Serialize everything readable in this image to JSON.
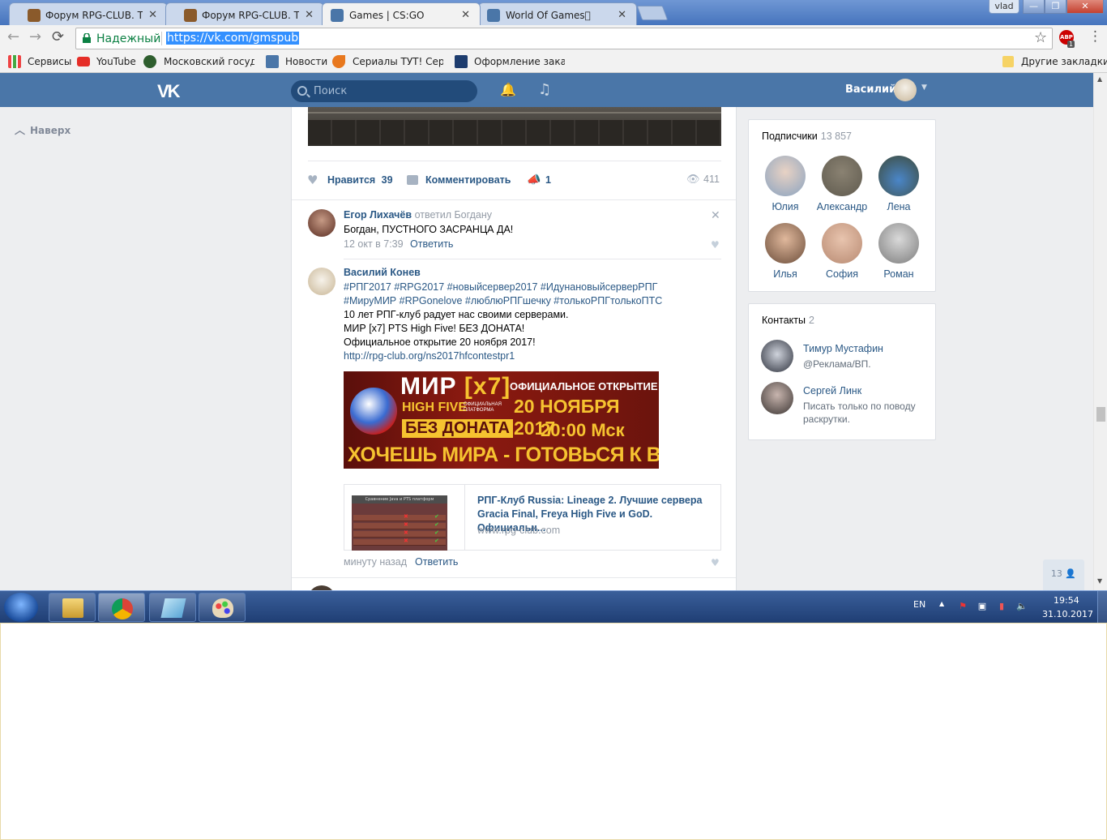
{
  "browser": {
    "tabs": [
      {
        "title": "Форум RPG-CLUB. Тема",
        "icon_color": "#8a5a2b",
        "active": false
      },
      {
        "title": "Форум RPG-CLUB. Тема",
        "icon_color": "#8a5a2b",
        "active": false
      },
      {
        "title": "Games | CS:GO",
        "icon_color": "#4a76a8",
        "active": true
      },
      {
        "title": "World Of Games\u0000",
        "icon_color": "#4a76a8",
        "active": false
      }
    ],
    "close_glyph": "✕",
    "profile_badge": "vlad",
    "window_controls": {
      "minimize": "—",
      "maximize": "❐",
      "close": "✕"
    },
    "nav": {
      "back": "←",
      "forward": "→",
      "reload": "⟳"
    },
    "secure_label": "Надежный",
    "url": "https://vk.com/gmspub",
    "star_glyph": "☆",
    "abp_label": "ABP",
    "abp_count": "1",
    "menu_glyph": "⋮",
    "bookmarks": [
      {
        "label": "Сервисы",
        "icon": "apps-grid-icon"
      },
      {
        "label": "YouTube",
        "icon": "youtube-icon"
      },
      {
        "label": "Московский государ",
        "icon": "emblem-icon"
      },
      {
        "label": "Новости",
        "icon": "vk-icon"
      },
      {
        "label": "Сериалы ТУТ! Сериа",
        "icon": "fox-icon"
      },
      {
        "label": "Оформление заказа",
        "icon": "sp-icon"
      }
    ],
    "other_bookmarks": "Другие закладки"
  },
  "vk": {
    "logo": "VK",
    "search_placeholder": "Поиск",
    "user_name": "Василий",
    "go_top": "Наверх",
    "post_actions": {
      "like_label": "Нравится",
      "like_count": "39",
      "comment_label": "Комментировать",
      "share_count": "1",
      "views": "411"
    },
    "comments": [
      {
        "author": "Егор Лихачёв",
        "replied": "ответил Богдану",
        "text": "Богдан, ПУСТНОГО ЗАСРАНЦА ДА!",
        "date": "12 окт в 7:39",
        "reply": "Ответить"
      },
      {
        "author": "Василий Конев",
        "hashtags1": "#РПГ2017 #RPG2017 #новыйсервер2017 #ИдунановыйсерверРПГ",
        "hashtags2": "#МируМИР #RPGonelove #люблюРПГшечку #толькоРПГтолькоПТС",
        "line1": "10 лет РПГ-клуб радует нас своими серверами.",
        "line2": "МИР [x7] PTS High Five! БЕЗ ДОНАТА!",
        "line3": "Официальное открытие 20 ноября 2017!",
        "link": "http://rpg-club.org/ns2017hfcontestpr1",
        "date": "минуту назад",
        "reply": "Ответить"
      }
    ],
    "banner": {
      "line1_a": "МИР ",
      "line1_b": "[x7]",
      "line2": "HIGH FIVE",
      "line2_small": "ОФИЦИАЛЬНАЯ ПЛАТФОРМА",
      "line3": "БЕЗ ДОНАТА",
      "right1": "ОФИЦИАЛЬНОЕ ОТКРЫТИЕ",
      "right2": "20 НОЯБРЯ 2017",
      "right3": "20:00 Мск",
      "bottom": "ХОЧЕШЬ МИРА - ГОТОВЬСЯ К ВОЙНЕ"
    },
    "link_card": {
      "title": "РПГ-Клуб Russia: Lineage 2. Лучшие сервера Gracia Final, Freya High Five и GoD. Официальн...",
      "domain": "www.rpg-club.com",
      "thumb_caption": "Сравнение Java и PTS платформ"
    },
    "subscribers": {
      "title": "Подписчики",
      "count": "13 857",
      "people": [
        {
          "name": "Юлия",
          "color": "#8aa3c0"
        },
        {
          "name": "Александр",
          "color": "#5f5a4e"
        },
        {
          "name": "Лена",
          "color": "#3e4b3a"
        },
        {
          "name": "Илья",
          "color": "#6b4d3a"
        },
        {
          "name": "София",
          "color": "#b88a72"
        },
        {
          "name": "Роман",
          "color": "#7d7d7d"
        }
      ]
    },
    "contacts": {
      "title": "Контакты",
      "count": "2",
      "people": [
        {
          "name": "Тимур Мустафин",
          "desc": "@Реклама/ВП.",
          "color": "#2b2f3a"
        },
        {
          "name": "Сергей Линк",
          "desc": "Писать только по поводу раскрутки.",
          "color": "#3a3432"
        }
      ]
    },
    "online_count": "13"
  },
  "taskbar": {
    "lang": "EN",
    "time": "19:54",
    "date": "31.10.2017"
  }
}
